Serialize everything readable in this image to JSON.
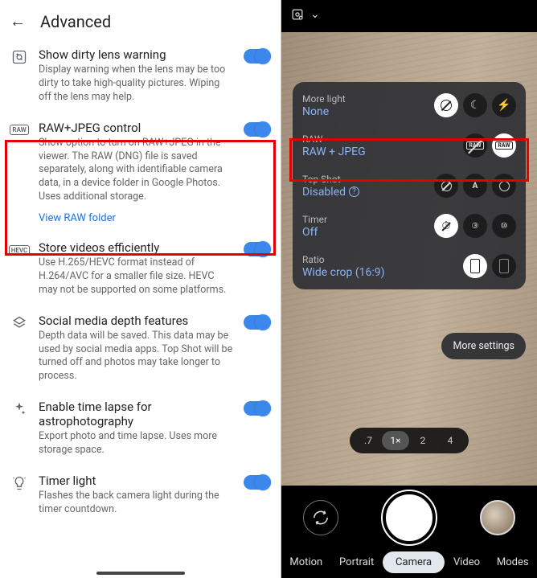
{
  "left": {
    "header_title": "Advanced",
    "settings": [
      {
        "icon": "dirty-lens",
        "title": "Show dirty lens warning",
        "desc": "Display warning when the lens may be too dirty to take high-quality pictures. Wiping off the lens may help."
      },
      {
        "icon": "raw",
        "title": "RAW+JPEG control",
        "desc": "Show option to turn on RAW+JPEG in the viewer. The RAW (DNG) file is saved separately, along with identifiable camera data, in a device folder in Google Photos. Uses additional storage.",
        "link": "View RAW folder"
      },
      {
        "icon": "hevc",
        "title": "Store videos efficiently",
        "desc": "Use H.265/HEVC format instead of H.264/AVC for a smaller file size. HEVC may not be supported on some platforms."
      },
      {
        "icon": "depth",
        "title": "Social media depth features",
        "desc": "Depth data will be saved. This data may be used by social media apps. Top Shot will be turned off and photos may take longer to process."
      },
      {
        "icon": "timelapse",
        "title": "Enable time lapse for astrophotography",
        "desc": "Export photo and time lapse. Uses more storage space."
      },
      {
        "icon": "timer-light",
        "title": "Timer light",
        "desc": "Flashes the back camera light during the timer countdown."
      }
    ]
  },
  "camera": {
    "panel": {
      "more_light": {
        "label": "More light",
        "value": "None"
      },
      "raw": {
        "label": "RAW",
        "value": "RAW + JPEG"
      },
      "top_shot": {
        "label": "Top Shot",
        "value": "Disabled"
      },
      "timer": {
        "label": "Timer",
        "value": "Off"
      },
      "ratio": {
        "label": "Ratio",
        "value": "Wide crop (16:9)"
      }
    },
    "more_settings": "More settings",
    "zoom": [
      ".7",
      "1×",
      "2",
      "4"
    ],
    "zoom_active": "1×",
    "modes": [
      "Motion",
      "Portrait",
      "Camera",
      "Video",
      "Modes"
    ],
    "mode_active": "Camera"
  }
}
